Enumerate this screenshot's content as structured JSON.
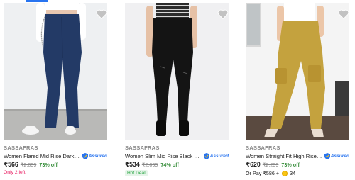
{
  "products": [
    {
      "brand": "SASSAFRAS",
      "title": "Women Flared Mid Rise Dark Blu...",
      "assured_label": "Assured",
      "price": "₹566",
      "mrp": "₹2,099",
      "discount": "73% off",
      "note": "Only 2 left",
      "jeans_color": "#233a66"
    },
    {
      "brand": "SASSAFRAS",
      "title": "Women Slim Mid Rise Black Jeans",
      "assured_label": "Assured",
      "price": "₹534",
      "mrp": "₹2,099",
      "discount": "74% off",
      "note": "Hot Deal",
      "jeans_color": "#141414"
    },
    {
      "brand": "SASSAFRAS",
      "title": "Women Straight Fit High Rise Br...",
      "assured_label": "Assured",
      "price": "₹620",
      "mrp": "₹2,299",
      "discount": "73% off",
      "offer_prefix": "Or Pay ₹586 +",
      "offer_coins": "34",
      "jeans_color": "#c4a23e"
    }
  ],
  "colors": {
    "accent": "#2874f0",
    "discount": "#388e3c",
    "stock_warning": "#e91e63",
    "hot_deal": "#26a541"
  }
}
